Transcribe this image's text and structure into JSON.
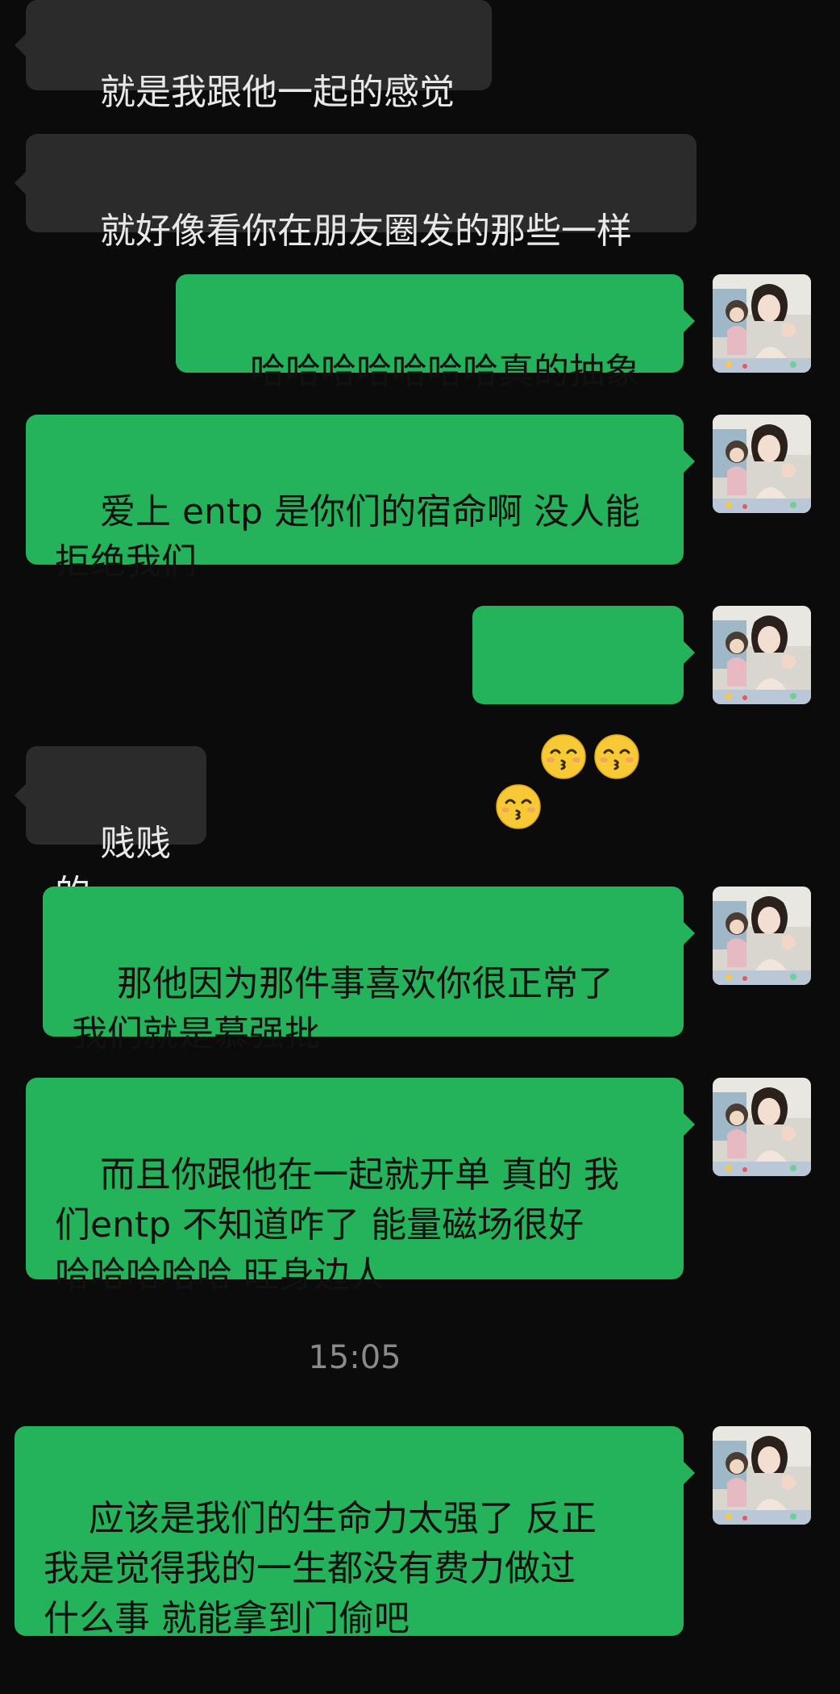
{
  "messages": [
    {
      "side": "in",
      "text": "就是我跟他一起的感觉"
    },
    {
      "side": "in",
      "text": "就好像看你在朋友圈发的那些一样"
    },
    {
      "side": "out",
      "text": "哈哈哈哈哈哈哈真的抽象"
    },
    {
      "side": "out",
      "text": "爱上 entp 是你们的宿命啊 没人能\n拒绝我们"
    },
    {
      "side": "out",
      "emoji": [
        "kissing-face-smiling-eyes",
        "kissing-face-smiling-eyes",
        "kissing-face-smiling-eyes"
      ]
    },
    {
      "side": "in",
      "text": "贱贱的"
    },
    {
      "side": "out",
      "text": "那他因为那件事喜欢你很正常了\n我们就是慕强批"
    },
    {
      "side": "out",
      "text": "而且你跟他在一起就开单 真的 我\n们entp 不知道咋了 能量磁场很好\n哈哈哈哈哈 旺身边人"
    },
    {
      "side": "out",
      "text": "应该是我们的生命力太强了 反正\n我是觉得我的一生都没有费力做过\n什么事 就能拿到门偷吧"
    }
  ],
  "timestamp": "15:05",
  "colors": {
    "background": "#0b0b0b",
    "incoming": "#2b2b2b",
    "outgoing": "#24b35a"
  },
  "avatar_icon": "user-avatar-photo"
}
